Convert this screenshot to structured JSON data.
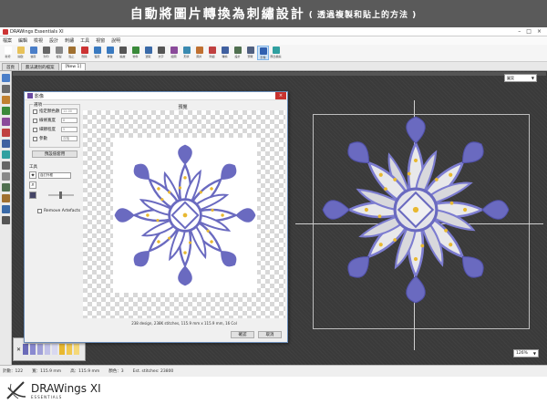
{
  "banner": {
    "title": "自動將圖片轉換為刺繡設計",
    "subtitle": "( 透過複製和貼上的方法 )"
  },
  "window": {
    "title": "DRAWings Essentials XI",
    "buttons": [
      "–",
      "□",
      "×"
    ]
  },
  "menu": [
    "檔案",
    "編輯",
    "檢視",
    "設計",
    "刺繡",
    "工具",
    "視窗",
    "說明"
  ],
  "toolbar": [
    {
      "label": "新增",
      "color": "#ffffff"
    },
    {
      "label": "開啟",
      "color": "#e8c25a"
    },
    {
      "label": "儲存",
      "color": "#4a7ec8"
    },
    {
      "label": "列印",
      "color": "#666666"
    },
    {
      "label": "複製",
      "color": "#888888"
    },
    {
      "label": "貼上",
      "color": "#a07030"
    },
    {
      "label": "刪除",
      "color": "#cc3333"
    },
    {
      "label": "復原",
      "color": "#3a7ac0"
    },
    {
      "label": "重做",
      "color": "#3a7ac0"
    },
    {
      "label": "縮放",
      "color": "#555555"
    },
    {
      "label": "物件",
      "color": "#3a8a3a"
    },
    {
      "label": "選取",
      "color": "#3a6aa8"
    },
    {
      "label": "文字",
      "color": "#555555"
    },
    {
      "label": "繪圖",
      "color": "#8a4a9a"
    },
    {
      "label": "形狀",
      "color": "#3a8ab0"
    },
    {
      "label": "圖片",
      "color": "#c07030"
    },
    {
      "label": "刺繡",
      "color": "#c04040"
    },
    {
      "label": "轉換",
      "color": "#4060a0"
    },
    {
      "label": "設計",
      "color": "#507050"
    },
    {
      "label": "預覽",
      "color": "#506080"
    },
    {
      "label": "影像",
      "color": "#3060b0"
    },
    {
      "label": "匯出檔案",
      "color": "#30a0a0"
    }
  ],
  "tabs": [
    {
      "label": "首頁"
    },
    {
      "label": "無法識別的檔案"
    },
    {
      "label": "[New 1]"
    }
  ],
  "dropdown_tr": "圖案",
  "zoom": "126%",
  "dialog": {
    "title": "影像",
    "close": "×",
    "options_label": "選項",
    "options": [
      {
        "label": "指定顏色數",
        "value": "12.00"
      },
      {
        "label": "線條寬度",
        "value": "8"
      },
      {
        "label": "細節程度",
        "value": "5"
      },
      {
        "label": "參數",
        "value": "灰階"
      }
    ],
    "apply_btn": "預設值套用",
    "tools_label": "工具",
    "tool_select": "自訂外框",
    "remove_bg": "Remove Artefacts",
    "preview_label": "預覽",
    "info": "238 design, 238K stitches, 115.9 mm x 115.9 mm, 16 Col",
    "ok": "確認",
    "cancel": "取消"
  },
  "palette_colors": [
    "#6a6ab8",
    "#8a8ad0",
    "#a0a0d8",
    "#c0c0e8",
    "#d8d8f0",
    "#e8b830",
    "#f0c850",
    "#f5d878"
  ],
  "statusbar": [
    "針數：122",
    "寬：115.9 mm",
    "高：115.9 mm",
    "顏色：3",
    "Est. stitches: 23800"
  ],
  "logo": {
    "brand": "DRAWings XI",
    "edition": "ESSENTIALS"
  }
}
